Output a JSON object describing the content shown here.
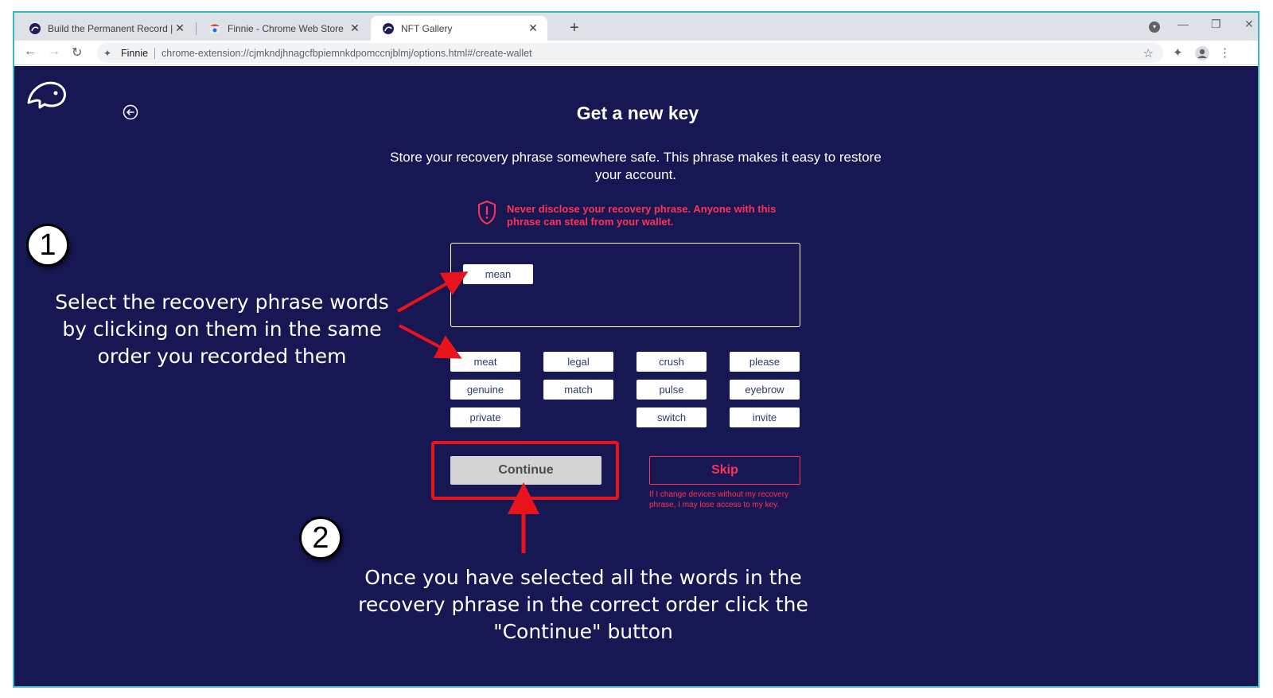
{
  "browser": {
    "tabs": [
      {
        "title": "Build the Permanent Record | Ko",
        "active": false
      },
      {
        "title": "Finnie - Chrome Web Store",
        "active": false
      },
      {
        "title": "NFT Gallery",
        "active": true
      }
    ],
    "omnibox": {
      "site": "Finnie",
      "url": "chrome-extension://cjmkndjhnagcfbpiemnkdpomccnjblmj/options.html#/create-wallet"
    }
  },
  "page": {
    "title": "Get a new key",
    "description": "Store your recovery phrase somewhere safe. This phrase makes it easy to restore your account.",
    "warning": "Never disclose your recovery phrase. Anyone with this phrase can steal from your wallet.",
    "selected_words": [
      "mean"
    ],
    "words": [
      "meat",
      "legal",
      "crush",
      "please",
      "genuine",
      "match",
      "pulse",
      "eyebrow",
      "private",
      "",
      "switch",
      "invite"
    ],
    "continue_label": "Continue",
    "skip_label": "Skip",
    "skip_note": "If I change devices without my recovery phrase, I may lose access to my key."
  },
  "annotations": {
    "badge1": "1",
    "badge2": "2",
    "step1": "Select the recovery phrase words by clicking on them in the same order you recorded them",
    "step2": "Once you have selected all the words in the recovery phrase in the correct order click the \"Continue\" button"
  },
  "colors": {
    "page_bg": "#171753",
    "warning": "#ff3355",
    "annotation_red": "#e8141c",
    "frame": "#3fb6c2"
  }
}
